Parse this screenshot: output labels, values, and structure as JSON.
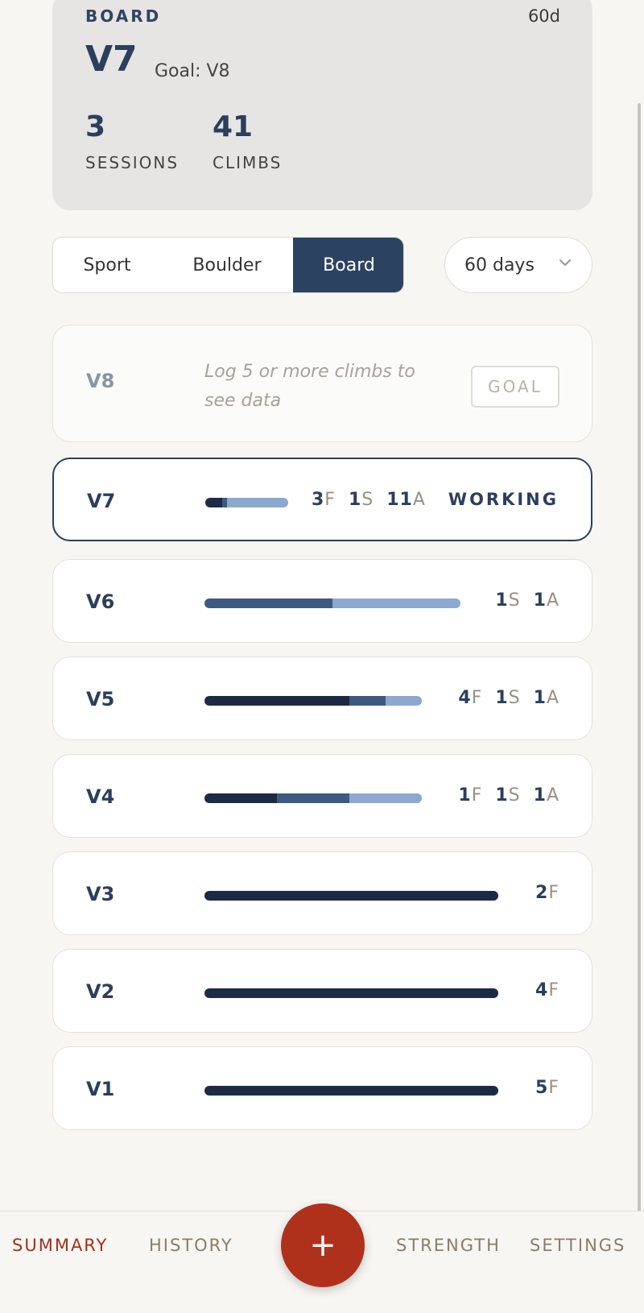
{
  "summary": {
    "label": "BOARD",
    "days": "60d",
    "grade": "V7",
    "goal": "Goal: V8",
    "sessions_value": "3",
    "sessions_label": "SESSIONS",
    "climbs_value": "41",
    "climbs_label": "CLIMBS"
  },
  "discipline_tabs": [
    "Sport",
    "Boulder",
    "Board"
  ],
  "active_tab": "Board",
  "range_select": {
    "value": "60 days",
    "icon": "chevron-down-icon"
  },
  "empty_grade": {
    "grade": "V8",
    "message": "Log 5 or more climbs to see data",
    "goal_button": "GOAL"
  },
  "grades": [
    {
      "grade": "V7",
      "segments": [
        {
          "type": "flash",
          "value": 3
        },
        {
          "type": "send",
          "value": 1
        },
        {
          "type": "attempt",
          "value": 11
        }
      ],
      "badge": "WORKING",
      "counts": [
        {
          "n": "3",
          "u": "F"
        },
        {
          "n": "1",
          "u": "S"
        },
        {
          "n": "11",
          "u": "A"
        }
      ]
    },
    {
      "grade": "V6",
      "segments": [
        {
          "type": "send",
          "value": 1
        },
        {
          "type": "attempt",
          "value": 1
        }
      ],
      "counts": [
        {
          "n": "1",
          "u": "S"
        },
        {
          "n": "1",
          "u": "A"
        }
      ]
    },
    {
      "grade": "V5",
      "segments": [
        {
          "type": "flash",
          "value": 4
        },
        {
          "type": "send",
          "value": 1
        },
        {
          "type": "attempt",
          "value": 1
        }
      ],
      "counts": [
        {
          "n": "4",
          "u": "F"
        },
        {
          "n": "1",
          "u": "S"
        },
        {
          "n": "1",
          "u": "A"
        }
      ]
    },
    {
      "grade": "V4",
      "segments": [
        {
          "type": "flash",
          "value": 1
        },
        {
          "type": "send",
          "value": 1
        },
        {
          "type": "attempt",
          "value": 1
        }
      ],
      "counts": [
        {
          "n": "1",
          "u": "F"
        },
        {
          "n": "1",
          "u": "S"
        },
        {
          "n": "1",
          "u": "A"
        }
      ]
    },
    {
      "grade": "V3",
      "segments": [
        {
          "type": "flash",
          "value": 2
        }
      ],
      "counts": [
        {
          "n": "2",
          "u": "F"
        }
      ]
    },
    {
      "grade": "V2",
      "segments": [
        {
          "type": "flash",
          "value": 4
        }
      ],
      "counts": [
        {
          "n": "4",
          "u": "F"
        }
      ]
    },
    {
      "grade": "V1",
      "segments": [
        {
          "type": "flash",
          "value": 5
        }
      ],
      "counts": [
        {
          "n": "5",
          "u": "F"
        }
      ]
    }
  ],
  "colors": {
    "flash": "#1c2a44",
    "send": "#3d5a80",
    "attempt": "#8ca8cf",
    "accent": "#b0311b"
  },
  "nav": {
    "summary": "SUMMARY",
    "history": "HISTORY",
    "add": "+",
    "strength": "STRENGTH",
    "settings": "SETTINGS"
  }
}
